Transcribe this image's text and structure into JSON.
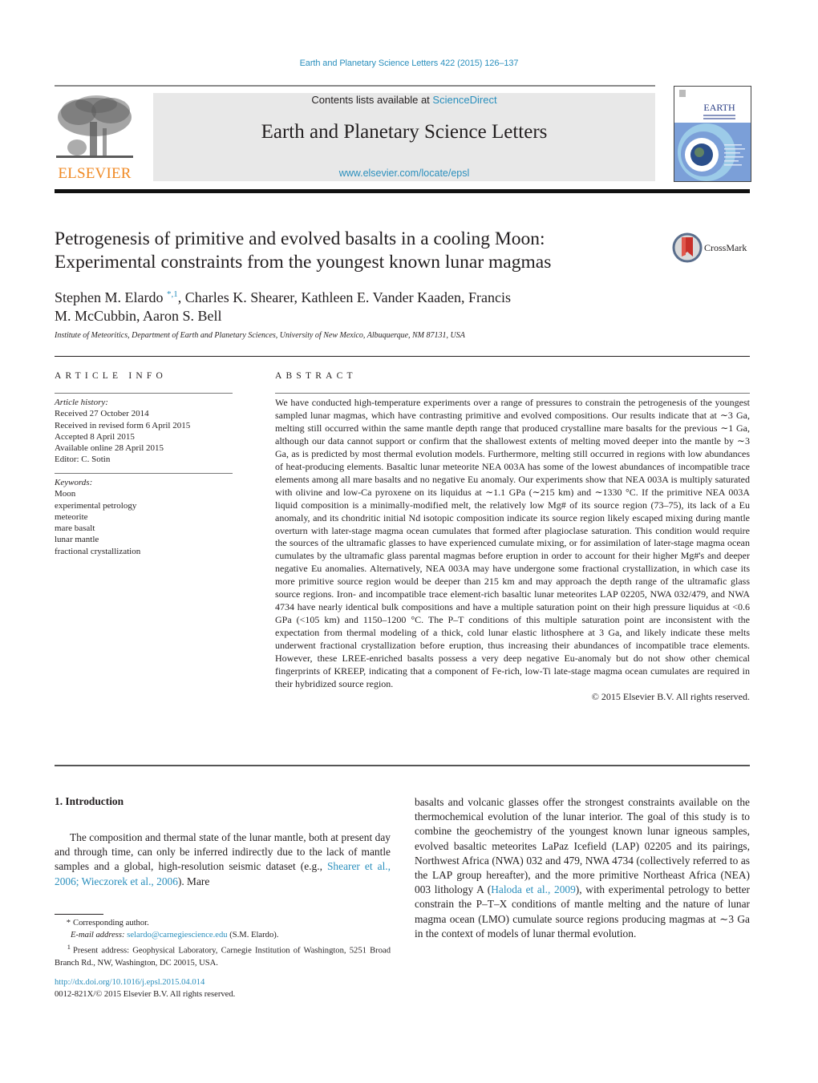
{
  "header": {
    "journal_reference": "Earth and Planetary Science Letters 422 (2015) 126–137",
    "contents_prefix": "Contents lists available at ",
    "contents_link": "ScienceDirect",
    "journal_title": "Earth and Planetary Science Letters",
    "journal_url": "www.elsevier.com/locate/epsl",
    "publisher_logo_text": "ELSEVIER",
    "cover_title": "EARTH",
    "cover_subtitle": "& PLANETARY SCIENCE LETTERS",
    "colors": {
      "link": "#2a8fbd",
      "elsevier_orange": "#f08a24",
      "masthead_bg": "#e8e8e8",
      "cover_blue": "#7b9fd8"
    }
  },
  "article": {
    "title_line1": "Petrogenesis of primitive and evolved basalts in a cooling Moon:",
    "title_line2": "Experimental constraints from the youngest known lunar magmas",
    "crossmark_label": "CrossMark",
    "authors_first": "Stephen M. Elardo",
    "authors_first_marks": "*,1",
    "authors_rest_line1": ", Charles K. Shearer, Kathleen E. Vander Kaaden, Francis",
    "authors_line2": "M. McCubbin, Aaron S. Bell",
    "affiliation": "Institute of Meteoritics, Department of Earth and Planetary Sciences, University of New Mexico, Albuquerque, NM 87131, USA"
  },
  "article_info": {
    "heading": "ARTICLE INFO",
    "history_label": "Article history:",
    "history": [
      "Received 27 October 2014",
      "Received in revised form 6 April 2015",
      "Accepted 8 April 2015",
      "Available online 28 April 2015",
      "Editor: C. Sotin"
    ],
    "keywords_label": "Keywords:",
    "keywords": [
      "Moon",
      "experimental petrology",
      "meteorite",
      "mare basalt",
      "lunar mantle",
      "fractional crystallization"
    ]
  },
  "abstract": {
    "heading": "ABSTRACT",
    "text": "We have conducted high-temperature experiments over a range of pressures to constrain the petrogenesis of the youngest sampled lunar magmas, which have contrasting primitive and evolved compositions. Our results indicate that at ∼3 Ga, melting still occurred within the same mantle depth range that produced crystalline mare basalts for the previous ∼1 Ga, although our data cannot support or confirm that the shallowest extents of melting moved deeper into the mantle by ∼3 Ga, as is predicted by most thermal evolution models. Furthermore, melting still occurred in regions with low abundances of heat-producing elements. Basaltic lunar meteorite NEA 003A has some of the lowest abundances of incompatible trace elements among all mare basalts and no negative Eu anomaly. Our experiments show that NEA 003A is multiply saturated with olivine and low-Ca pyroxene on its liquidus at ∼1.1 GPa (∼215 km) and ∼1330 °C. If the primitive NEA 003A liquid composition is a minimally-modified melt, the relatively low Mg# of its source region (73–75), its lack of a Eu anomaly, and its chondritic initial Nd isotopic composition indicate its source region likely escaped mixing during mantle overturn with later-stage magma ocean cumulates that formed after plagioclase saturation. This condition would require the sources of the ultramafic glasses to have experienced cumulate mixing, or for assimilation of later-stage magma ocean cumulates by the ultramafic glass parental magmas before eruption in order to account for their higher Mg#'s and deeper negative Eu anomalies. Alternatively, NEA 003A may have undergone some fractional crystallization, in which case its more primitive source region would be deeper than 215 km and may approach the depth range of the ultramafic glass source regions. Iron- and incompatible trace element-rich basaltic lunar meteorites LAP 02205, NWA 032/479, and NWA 4734 have nearly identical bulk compositions and have a multiple saturation point on their high pressure liquidus at <0.6 GPa (<105 km) and 1150–1200 °C. The P–T conditions of this multiple saturation point are inconsistent with the expectation from thermal modeling of a thick, cold lunar elastic lithosphere at 3 Ga, and likely indicate these melts underwent fractional crystallization before eruption, thus increasing their abundances of incompatible trace elements. However, these LREE-enriched basalts possess a very deep negative Eu-anomaly but do not show other chemical fingerprints of KREEP, indicating that a component of Fe-rich, low-Ti late-stage magma ocean cumulates are required in their hybridized source region.",
    "copyright": "© 2015 Elsevier B.V. All rights reserved."
  },
  "introduction": {
    "heading": "1.  Introduction",
    "left_text_before_cite": "The composition and thermal state of the lunar mantle, both at present day and through time, can only be inferred indirectly due to the lack of mantle samples and a global, high-resolution seismic dataset (e.g., ",
    "left_cite": "Shearer et al., 2006; Wieczorek et al., 2006",
    "left_text_after_cite": "). Mare",
    "right_text_before_cite": "basalts and volcanic glasses offer the strongest constraints available on the thermochemical evolution of the lunar interior. The goal of this study is to combine the geochemistry of the youngest known lunar igneous samples, evolved basaltic meteorites LaPaz Icefield (LAP) 02205 and its pairings, Northwest Africa (NWA) 032 and 479, NWA 4734 (collectively referred to as the LAP group hereafter), and the more primitive Northeast Africa (NEA) 003 lithology A (",
    "right_cite": "Haloda et al., 2009",
    "right_text_after_cite": "), with experimental petrology to better constrain the P–T–X conditions of mantle melting and the nature of lunar magma ocean (LMO) cumulate source regions producing magmas at ∼3 Ga in the context of models of lunar thermal evolution."
  },
  "footnotes": {
    "corresponding_mark": "*",
    "corresponding_text": "Corresponding author.",
    "email_label": "E-mail address:",
    "email": "selardo@carnegiescience.edu",
    "email_suffix": " (S.M. Elardo).",
    "present_mark": "1",
    "present_text": "Present address: Geophysical Laboratory, Carnegie Institution of Washington, 5251 Broad Branch Rd., NW, Washington, DC 20015, USA."
  },
  "doi": {
    "url": "http://dx.doi.org/10.1016/j.epsl.2015.04.014",
    "issn_line": "0012-821X/© 2015 Elsevier B.V. All rights reserved."
  }
}
